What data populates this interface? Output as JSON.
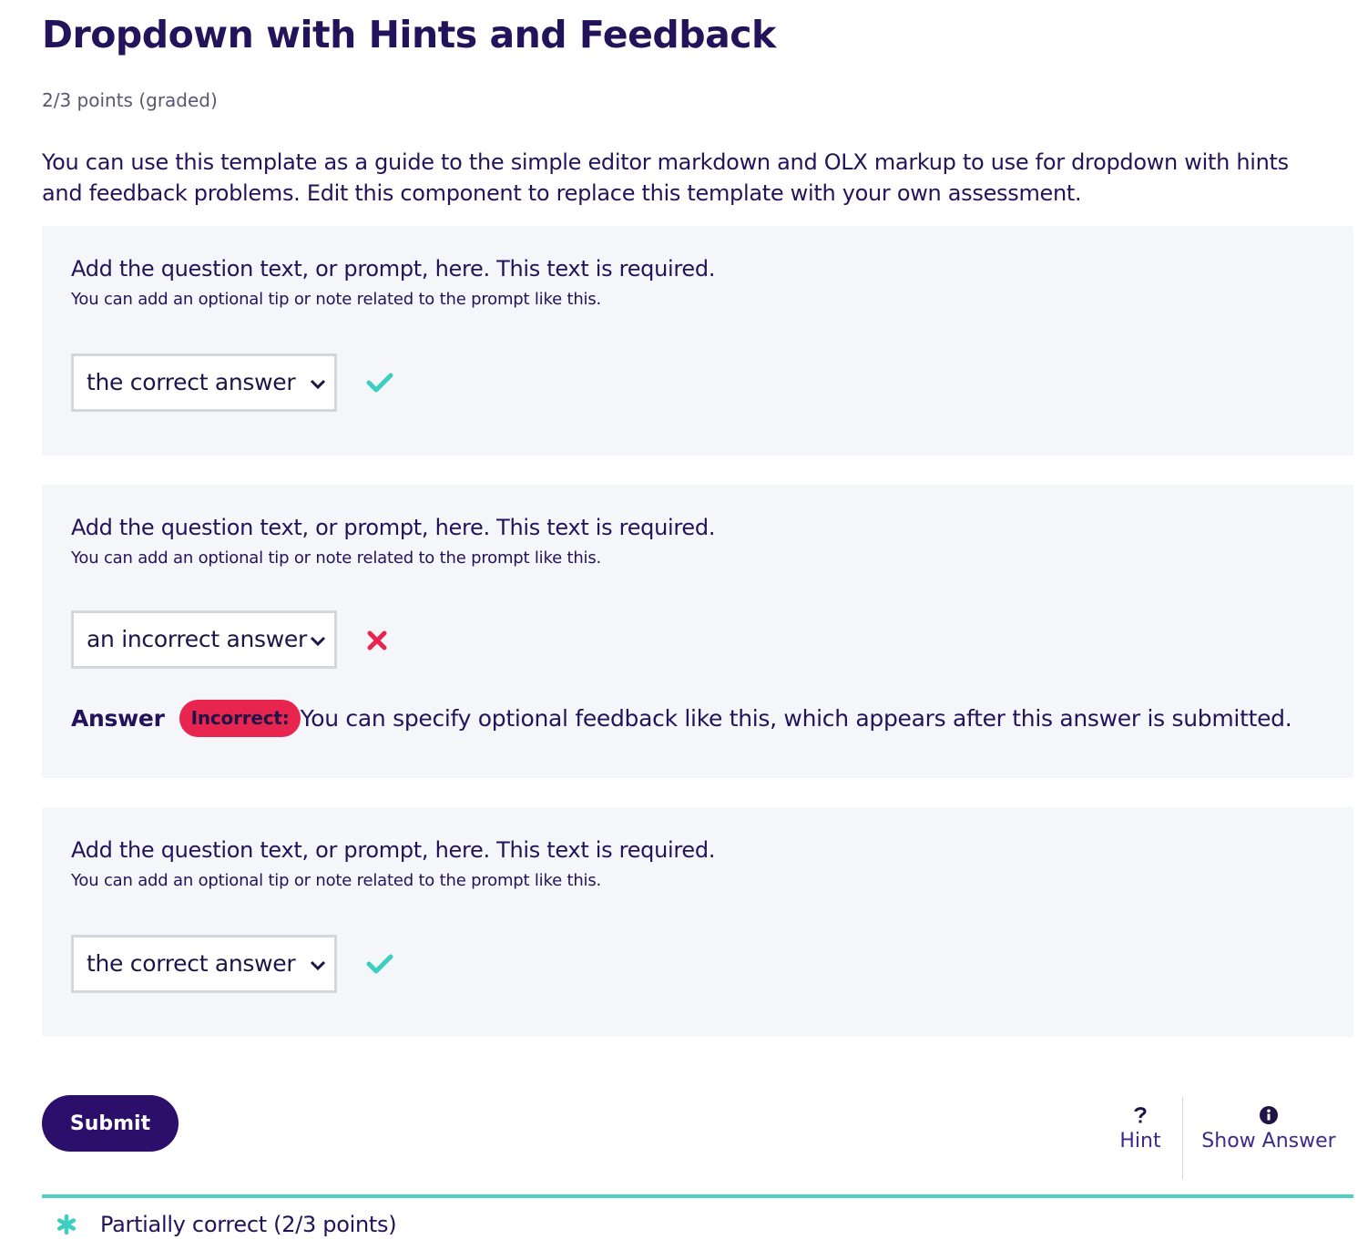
{
  "problem": {
    "title": "Dropdown with Hints and Feedback",
    "points": "2/3 points (graded)",
    "intro": "You can use this template as a guide to the simple editor markdown and OLX markup to use for dropdown with hints and feedback problems. Edit this component to replace this template with your own assessment."
  },
  "questions": [
    {
      "prompt": "Add the question text, or prompt, here. This text is required.",
      "tip": "You can add an optional tip or note related to the prompt like this.",
      "selected": "the correct answer",
      "status_icon": "check-icon"
    },
    {
      "prompt": "Add the question text, or prompt, here. This text is required.",
      "tip": "You can add an optional tip or note related to the prompt like this.",
      "selected": "an incorrect answer",
      "status_icon": "x-icon",
      "feedback": {
        "label": "Answer",
        "badge": "Incorrect:",
        "text": "You can specify optional feedback like this, which appears after this answer is submitted."
      }
    },
    {
      "prompt": "Add the question text, or prompt, here. This text is required.",
      "tip": "You can add an optional tip or note related to the prompt like this.",
      "selected": "the correct answer",
      "status_icon": "check-icon"
    }
  ],
  "actions": {
    "submit_label": "Submit",
    "hint_label": "Hint",
    "hint_icon": "question-icon",
    "show_answer_label": "Show Answer",
    "show_answer_icon": "info-icon"
  },
  "result": {
    "text": "Partially correct (2/3 points)",
    "icon": "asterisk-icon"
  },
  "colors": {
    "correct": "#3ccfc0",
    "incorrect": "#e8254e",
    "primary": "#2c0e6b"
  }
}
